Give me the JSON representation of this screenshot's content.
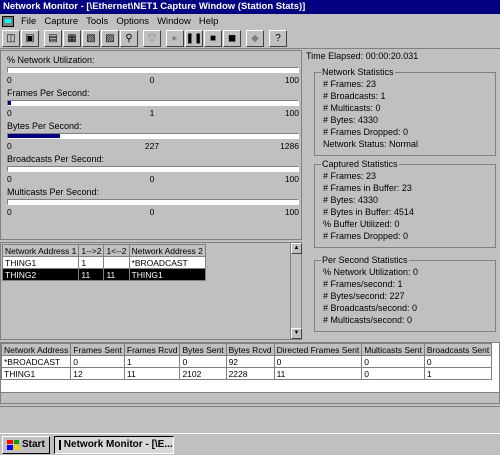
{
  "window": {
    "title": "Network Monitor - [\\Ethernet\\NET1 Capture Window (Station Stats)]"
  },
  "menu": [
    "File",
    "Capture",
    "Tools",
    "Options",
    "Window",
    "Help"
  ],
  "toolbar": {
    "icons": [
      "new-icon",
      "save-icon",
      "pane-graph-icon",
      "pane-session-icon",
      "pane-station-icon",
      "pane-total-icon",
      "zoom-icon",
      "filter-icon",
      "start-capture-icon",
      "pause-icon",
      "stop-icon",
      "stop-view-icon",
      "view-icon",
      "help-icon"
    ]
  },
  "meters": [
    {
      "label": "% Network Utilization:",
      "min": "0",
      "current": "0",
      "max": "100",
      "fraction": 0
    },
    {
      "label": "Frames Per Second:",
      "min": "0",
      "current": "1",
      "max": "100",
      "fraction": 0.01
    },
    {
      "label": "Bytes Per Second:",
      "min": "0",
      "current": "227",
      "max": "1286",
      "fraction": 0.18
    },
    {
      "label": "Broadcasts Per Second:",
      "min": "0",
      "current": "0",
      "max": "100",
      "fraction": 0
    },
    {
      "label": "Multicasts Per Second:",
      "min": "0",
      "current": "0",
      "max": "100",
      "fraction": 0
    }
  ],
  "elapsed": "Time Elapsed: 00:00:20.031",
  "groups": {
    "network": {
      "title": "Network Statistics",
      "lines": [
        "# Frames: 23",
        "# Broadcasts: 1",
        "# Multicasts: 0",
        "# Bytes: 4330",
        "# Frames Dropped: 0",
        "Network Status: Normal"
      ]
    },
    "captured": {
      "title": "Captured Statistics",
      "lines": [
        "# Frames: 23",
        "# Frames in Buffer: 23",
        "# Bytes: 4330",
        "# Bytes in Buffer: 4514",
        "% Buffer Utilized: 0",
        "# Frames Dropped: 0"
      ]
    },
    "persecond": {
      "title": "Per Second Statistics",
      "lines": [
        "% Network Utilization: 0",
        "# Frames/second: 1",
        "# Bytes/second: 227",
        "# Broadcasts/second: 0",
        "# Multicasts/second: 0"
      ]
    }
  },
  "session": {
    "headers": [
      "Network Address 1",
      "1-->2",
      "1<--2",
      "Network Address 2"
    ],
    "rows": [
      [
        "THING1",
        "1",
        "",
        "*BROADCAST"
      ],
      [
        "THING2",
        "11",
        "11",
        "THING1"
      ]
    ],
    "selected_row": 1
  },
  "hosts": {
    "headers": [
      "Network Address",
      "Frames Sent",
      "Frames Rcvd",
      "Bytes Sent",
      "Bytes Rcvd",
      "Directed Frames Sent",
      "Multicasts Sent",
      "Broadcasts Sent"
    ],
    "rows": [
      [
        "*BROADCAST",
        "0",
        "1",
        "0",
        "92",
        "0",
        "0",
        "0"
      ],
      [
        "THING1",
        "12",
        "11",
        "2102",
        "2228",
        "11",
        "0",
        "1"
      ]
    ]
  },
  "taskbar": {
    "start": "Start",
    "task": "Network Monitor - [\\E..."
  },
  "colors": {
    "title_bar": "#000080",
    "meter_fill": "#000080",
    "selection": "#000000",
    "face": "#c0c0c0"
  }
}
